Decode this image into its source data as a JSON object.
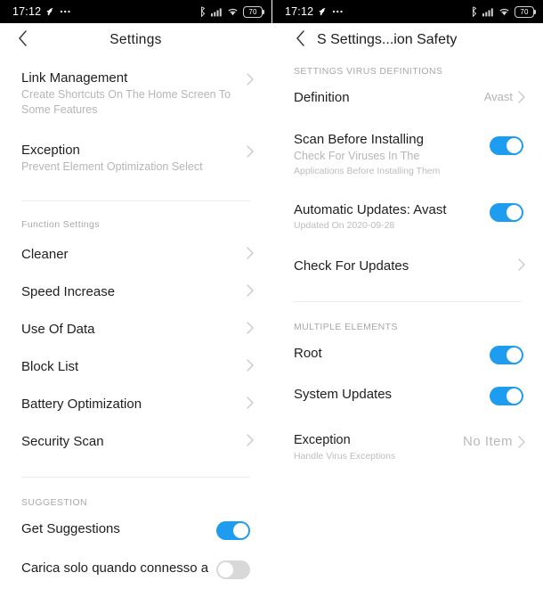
{
  "left_phone": {
    "statusbar": {
      "time": "17:12",
      "icons_left": [
        "rocket-icon",
        "dots-icon"
      ],
      "icons_right": [
        "bluetooth-icon",
        "signal-icon",
        "wifi-icon"
      ],
      "battery_level": "70"
    },
    "nav": {
      "back_icon": "chevron-left-icon",
      "title": "Settings"
    },
    "rows": [
      {
        "title": "Link Management",
        "subtitle": "Create Shortcuts On The Home Screen To Some Features",
        "accessory": "chevron"
      },
      {
        "title": "Exception",
        "subtitle": "Prevent Element Optimization Select",
        "accessory": "chevron"
      }
    ],
    "section_function": {
      "header": "Function Settings",
      "rows": [
        {
          "title": "Cleaner",
          "accessory": "chevron"
        },
        {
          "title": "Speed Increase",
          "accessory": "chevron"
        },
        {
          "title": "Use Of Data",
          "accessory": "chevron"
        },
        {
          "title": "Block List",
          "accessory": "chevron"
        },
        {
          "title": "Battery Optimization",
          "accessory": "chevron"
        },
        {
          "title": "Security Scan",
          "accessory": "chevron"
        }
      ]
    },
    "section_suggestion": {
      "header": "SUGGESTION",
      "rows": [
        {
          "title": "Get Suggestions",
          "accessory": "toggle",
          "toggle_on": true
        },
        {
          "title": "Carica solo quando connesso a",
          "accessory": "toggle",
          "toggle_on": false
        }
      ]
    }
  },
  "right_phone": {
    "statusbar": {
      "time": "17:12",
      "icons_left": [
        "rocket-icon",
        "dots-icon"
      ],
      "icons_right": [
        "bluetooth-icon",
        "signal-icon",
        "wifi-icon"
      ],
      "battery_level": "70"
    },
    "nav": {
      "back_icon": "chevron-left-icon",
      "title": "S Settings...ion Safety"
    },
    "section_virus": {
      "header": "SETTINGS VIRUS DEFINITIONS",
      "rows": [
        {
          "title": "Definition",
          "value": "Avast",
          "accessory": "chevron"
        },
        {
          "title": "Scan Before Installing",
          "subtitle": "Check For Viruses In The",
          "subtitle2": "Applications Before Installing Them",
          "accessory": "toggle",
          "toggle_on": true
        },
        {
          "title": "Automatic Updates: Avast",
          "subtitle": "Updated On 2020-09-28",
          "accessory": "toggle",
          "toggle_on": true
        },
        {
          "title": "Check For Updates",
          "accessory": "chevron"
        }
      ]
    },
    "section_multiple": {
      "header": "MULTIPLE ELEMENTS",
      "rows": [
        {
          "title": "Root",
          "accessory": "toggle",
          "toggle_on": true
        },
        {
          "title": "System Updates",
          "accessory": "toggle",
          "toggle_on": true
        },
        {
          "title": "Exception",
          "subtitle": "Handle Virus Exceptions",
          "value": "No Item",
          "accessory": "chevron"
        }
      ]
    }
  }
}
